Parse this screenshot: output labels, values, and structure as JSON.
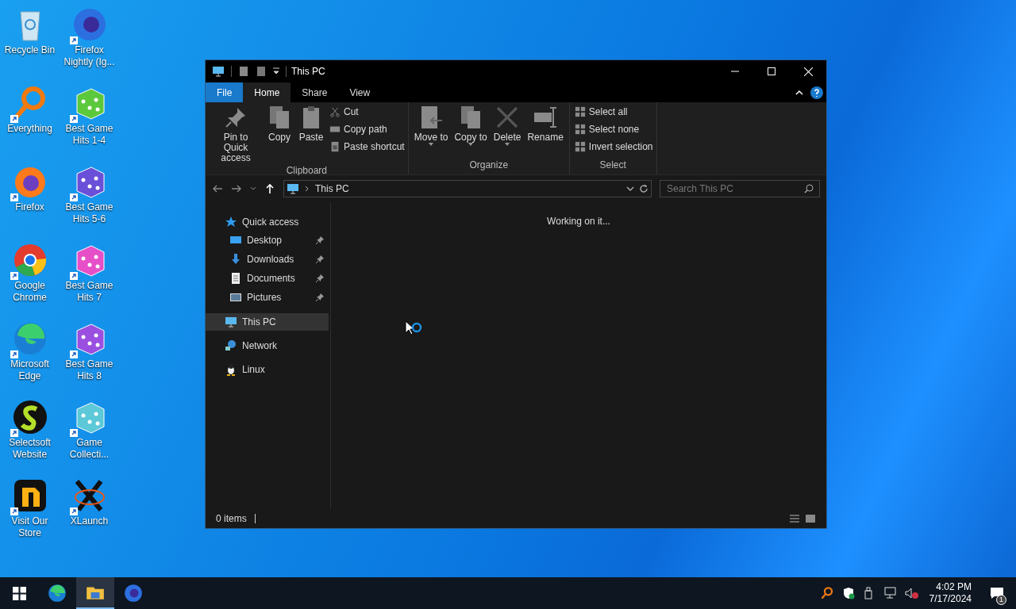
{
  "desktop_icons": [
    {
      "label": "Recycle Bin",
      "kind": "recycle"
    },
    {
      "label": "Firefox Nightly (Ig...",
      "kind": "nightly"
    },
    {
      "label": "Everything",
      "kind": "everything"
    },
    {
      "label": "Best Game Hits 1-4",
      "kind": "dice",
      "color": "#5cc83c"
    },
    {
      "label": "Firefox",
      "kind": "firefox"
    },
    {
      "label": "Best Game Hits 5-6",
      "kind": "dice",
      "color": "#6a4fd8"
    },
    {
      "label": "Google Chrome",
      "kind": "chrome"
    },
    {
      "label": "Best Game Hits 7",
      "kind": "dice",
      "color": "#e64fc8"
    },
    {
      "label": "Microsoft Edge",
      "kind": "edge"
    },
    {
      "label": "Best Game Hits 8",
      "kind": "dice",
      "color": "#9a4fe0"
    },
    {
      "label": "Selectsoft Website",
      "kind": "selectsoft"
    },
    {
      "label": "Game Collecti...",
      "kind": "dice",
      "color": "#5cc8d8"
    },
    {
      "label": "Visit Our Store",
      "kind": "store"
    },
    {
      "label": "XLaunch",
      "kind": "xlaunch"
    }
  ],
  "window": {
    "title": "This PC",
    "ribbon_tabs": [
      {
        "label": "File",
        "kind": "file",
        "selected": false
      },
      {
        "label": "Home",
        "kind": "tab",
        "selected": true
      },
      {
        "label": "Share",
        "kind": "tab",
        "selected": false
      },
      {
        "label": "View",
        "kind": "tab",
        "selected": false
      }
    ],
    "ribbon_groups": [
      {
        "name": "Clipboard",
        "large": [
          {
            "label": "Pin to Quick access",
            "kind": "pin"
          },
          {
            "label": "Copy",
            "kind": "copy"
          },
          {
            "label": "Paste",
            "kind": "paste"
          }
        ],
        "small": [
          {
            "label": "Cut",
            "kind": "cut"
          },
          {
            "label": "Copy path",
            "kind": "path"
          },
          {
            "label": "Paste shortcut",
            "kind": "shortcut"
          }
        ]
      },
      {
        "name": "Organize",
        "large": [
          {
            "label": "Move to",
            "kind": "move",
            "dropdown": true
          },
          {
            "label": "Copy to",
            "kind": "copy",
            "dropdown": true
          },
          {
            "label": "Delete",
            "kind": "delete",
            "dropdown": true
          },
          {
            "label": "Rename",
            "kind": "rename",
            "dropdown": false
          }
        ]
      },
      {
        "name": "Select",
        "small": [
          {
            "label": "Select all",
            "kind": "grid"
          },
          {
            "label": "Select none",
            "kind": "grid"
          },
          {
            "label": "Invert selection",
            "kind": "grid"
          }
        ]
      }
    ],
    "address": "This PC",
    "search": {
      "placeholder": "Search This PC"
    },
    "nav": [
      {
        "label": "Quick access",
        "kind": "star",
        "selected": false,
        "children": [
          {
            "label": "Desktop",
            "kind": "desktop",
            "pinned": true
          },
          {
            "label": "Downloads",
            "kind": "download",
            "pinned": true
          },
          {
            "label": "Documents",
            "kind": "document",
            "pinned": true
          },
          {
            "label": "Pictures",
            "kind": "picture",
            "pinned": true
          }
        ]
      },
      {
        "label": "This PC",
        "kind": "pc",
        "selected": true
      },
      {
        "label": "Network",
        "kind": "network",
        "selected": false
      },
      {
        "label": "Linux",
        "kind": "linux",
        "selected": false
      }
    ],
    "content_message": "Working on it...",
    "status": "0 items"
  },
  "taskbar": {
    "apps": [
      {
        "kind": "edge",
        "active": false
      },
      {
        "kind": "folder",
        "active": true
      },
      {
        "kind": "nightly",
        "active": false
      }
    ],
    "time": "4:02 PM",
    "date": "7/17/2024",
    "notifications": "1"
  }
}
